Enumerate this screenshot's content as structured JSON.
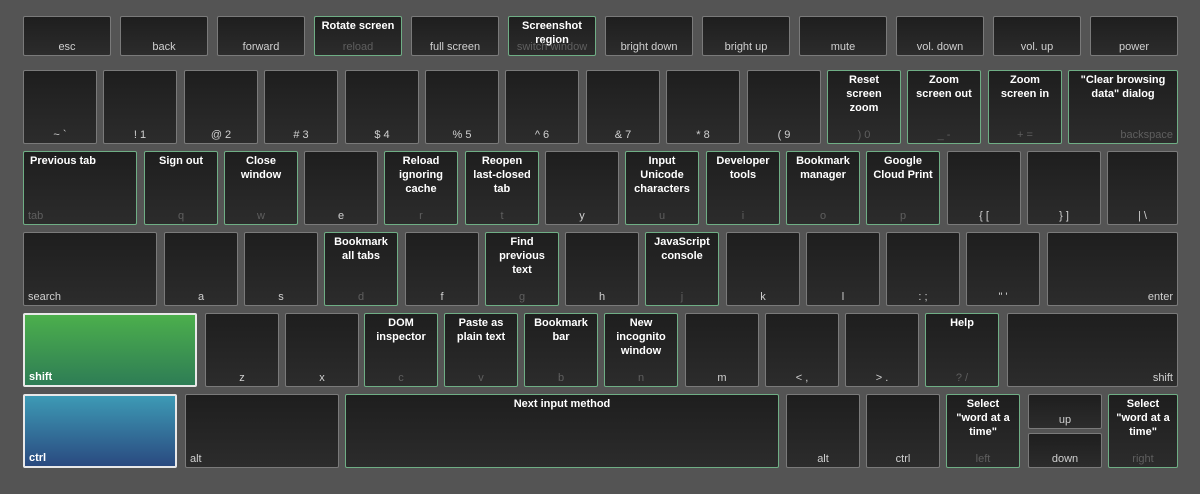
{
  "keyboard": {
    "rows": [
      [
        {
          "label": "esc"
        },
        {
          "label": "back"
        },
        {
          "label": "forward"
        },
        {
          "label": "reload",
          "shortcut": "Rotate screen"
        },
        {
          "label": "full screen"
        },
        {
          "label": "switch window",
          "shortcut": "Screenshot\nregion"
        },
        {
          "label": "bright down"
        },
        {
          "label": "bright up"
        },
        {
          "label": "mute"
        },
        {
          "label": "vol. down"
        },
        {
          "label": "vol. up"
        },
        {
          "label": "power"
        }
      ],
      [
        {
          "label": "~ `"
        },
        {
          "label": "! 1"
        },
        {
          "label": "@ 2"
        },
        {
          "label": "# 3"
        },
        {
          "label": "$ 4"
        },
        {
          "label": "% 5"
        },
        {
          "label": "^ 6"
        },
        {
          "label": "& 7"
        },
        {
          "label": "* 8"
        },
        {
          "label": "( 9"
        },
        {
          "label": ") 0",
          "shortcut": "Reset\nscreen\nzoom"
        },
        {
          "label": "_ -",
          "shortcut": "Zoom\nscreen out"
        },
        {
          "label": "+ =",
          "shortcut": "Zoom\nscreen in"
        },
        {
          "label": "backspace",
          "shortcut": "\"Clear browsing\ndata\" dialog"
        }
      ],
      [
        {
          "label": "tab",
          "shortcut": "Previous tab"
        },
        {
          "label": "q",
          "shortcut": "Sign out"
        },
        {
          "label": "w",
          "shortcut": "Close\nwindow"
        },
        {
          "label": "e"
        },
        {
          "label": "r",
          "shortcut": "Reload\nignoring\ncache"
        },
        {
          "label": "t",
          "shortcut": "Reopen\nlast-closed\ntab"
        },
        {
          "label": "y"
        },
        {
          "label": "u",
          "shortcut": "Input\nUnicode\ncharacters"
        },
        {
          "label": "i",
          "shortcut": "Developer\ntools"
        },
        {
          "label": "o",
          "shortcut": "Bookmark\nmanager"
        },
        {
          "label": "p",
          "shortcut": "Google\nCloud Print"
        },
        {
          "label": "{ ["
        },
        {
          "label": "} ]"
        },
        {
          "label": "| \\"
        }
      ],
      [
        {
          "label": "search"
        },
        {
          "label": "a"
        },
        {
          "label": "s"
        },
        {
          "label": "d",
          "shortcut": "Bookmark\nall tabs"
        },
        {
          "label": "f"
        },
        {
          "label": "g",
          "shortcut": "Find\nprevious\ntext"
        },
        {
          "label": "h"
        },
        {
          "label": "j",
          "shortcut": "JavaScript\nconsole"
        },
        {
          "label": "k"
        },
        {
          "label": "l"
        },
        {
          "label": ": ;"
        },
        {
          "label": "\" '"
        },
        {
          "label": "enter"
        }
      ],
      [
        {
          "label": "shift"
        },
        {
          "label": "z"
        },
        {
          "label": "x"
        },
        {
          "label": "c",
          "shortcut": "DOM\ninspector"
        },
        {
          "label": "v",
          "shortcut": "Paste as\nplain text"
        },
        {
          "label": "b",
          "shortcut": "Bookmark\nbar"
        },
        {
          "label": "n",
          "shortcut": "New\nincognito\nwindow"
        },
        {
          "label": "m"
        },
        {
          "label": "< ,"
        },
        {
          "label": "> ."
        },
        {
          "label": "? /",
          "shortcut": "Help"
        },
        {
          "label": "shift"
        }
      ],
      [
        {
          "label": "ctrl"
        },
        {
          "label": "alt"
        },
        {
          "label": "",
          "shortcut": "Next input method"
        },
        {
          "label": "alt"
        },
        {
          "label": "ctrl"
        },
        {
          "label": "left",
          "shortcut": "Select\n\"word at a\ntime\""
        },
        {
          "label": "up"
        },
        {
          "label": "down"
        },
        {
          "label": "right",
          "shortcut": "Select\n\"word at a\ntime\""
        }
      ]
    ],
    "colors": {
      "background": "#545454",
      "key": "#242424",
      "shortcut_border": "#6fae85",
      "shift_highlight": "#4caf4c",
      "ctrl_highlight": "#3d9ab5"
    }
  }
}
